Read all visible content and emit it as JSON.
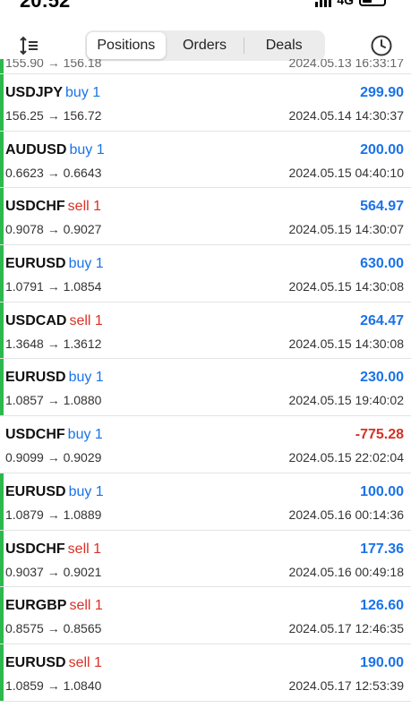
{
  "status": {
    "time": "20:52",
    "network": "4G"
  },
  "toolbar": {
    "tabs": [
      {
        "label": "Positions",
        "active": true
      },
      {
        "label": "Orders",
        "active": false
      },
      {
        "label": "Deals",
        "active": false
      }
    ]
  },
  "colors": {
    "buy": "#1a73e8",
    "sell": "#d93025",
    "profit": "#1a73e8",
    "loss": "#d93025",
    "indicator": "#2db84d"
  },
  "partial_row": {
    "prices": "155.90 → 156.18",
    "time": "2024.05.13 16:33:17"
  },
  "deals": [
    {
      "symbol": "USDJPY",
      "side": "buy 1",
      "prices": "156.25 → 156.72",
      "pl": "299.90",
      "time": "2024.05.14 14:30:37",
      "indicator": true,
      "profit": true
    },
    {
      "symbol": "AUDUSD",
      "side": "buy 1",
      "prices": "0.6623 → 0.6643",
      "pl": "200.00",
      "time": "2024.05.15 04:40:10",
      "indicator": true,
      "profit": true
    },
    {
      "symbol": "USDCHF",
      "side": "sell 1",
      "prices": "0.9078 → 0.9027",
      "pl": "564.97",
      "time": "2024.05.15 14:30:07",
      "indicator": true,
      "profit": true
    },
    {
      "symbol": "EURUSD",
      "side": "buy 1",
      "prices": "1.0791 → 1.0854",
      "pl": "630.00",
      "time": "2024.05.15 14:30:08",
      "indicator": true,
      "profit": true
    },
    {
      "symbol": "USDCAD",
      "side": "sell 1",
      "prices": "1.3648 → 1.3612",
      "pl": "264.47",
      "time": "2024.05.15 14:30:08",
      "indicator": true,
      "profit": true
    },
    {
      "symbol": "EURUSD",
      "side": "buy 1",
      "prices": "1.0857 → 1.0880",
      "pl": "230.00",
      "time": "2024.05.15 19:40:02",
      "indicator": true,
      "profit": true
    },
    {
      "symbol": "USDCHF",
      "side": "buy 1",
      "prices": "0.9099 → 0.9029",
      "pl": "-775.28",
      "time": "2024.05.15 22:02:04",
      "indicator": false,
      "profit": false
    },
    {
      "symbol": "EURUSD",
      "side": "buy 1",
      "prices": "1.0879 → 1.0889",
      "pl": "100.00",
      "time": "2024.05.16 00:14:36",
      "indicator": true,
      "profit": true
    },
    {
      "symbol": "USDCHF",
      "side": "sell 1",
      "prices": "0.9037 → 0.9021",
      "pl": "177.36",
      "time": "2024.05.16 00:49:18",
      "indicator": true,
      "profit": true
    },
    {
      "symbol": "EURGBP",
      "side": "sell 1",
      "prices": "0.8575 → 0.8565",
      "pl": "126.60",
      "time": "2024.05.17 12:46:35",
      "indicator": true,
      "profit": true
    },
    {
      "symbol": "EURUSD",
      "side": "sell 1",
      "prices": "1.0859 → 1.0840",
      "pl": "190.00",
      "time": "2024.05.17 12:53:39",
      "indicator": true,
      "profit": true
    }
  ]
}
